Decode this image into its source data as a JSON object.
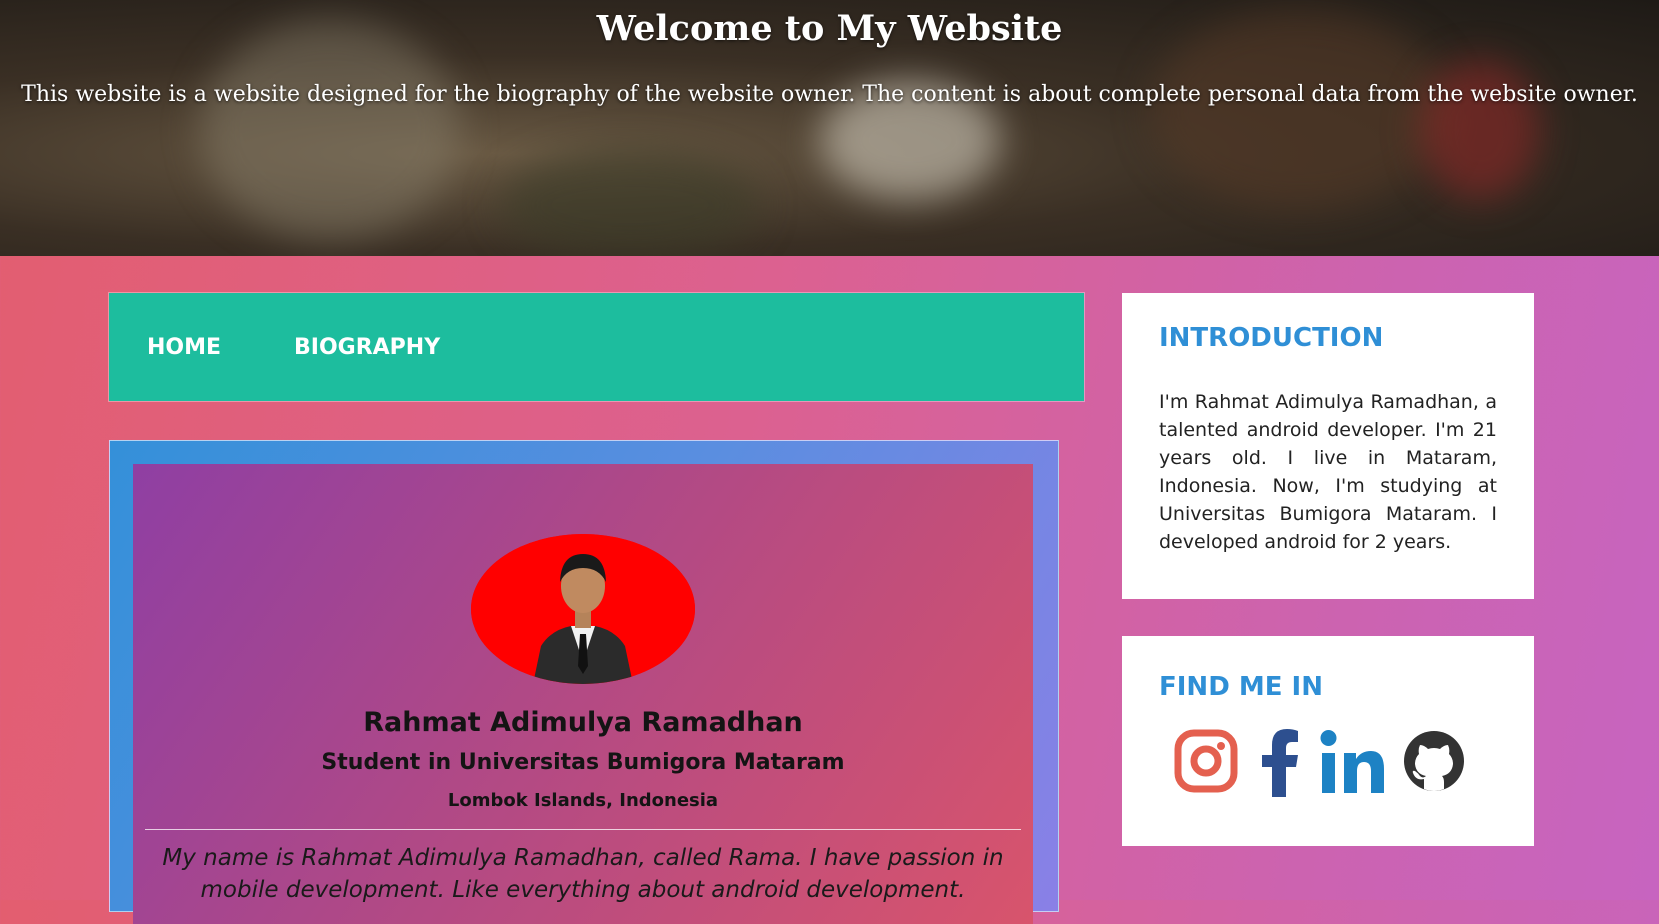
{
  "header": {
    "title": "Welcome to My Website",
    "subtitle": "This website is a website designed for the biography of the website owner. The content is about complete personal data from the website owner."
  },
  "nav": {
    "home_label": "HOME",
    "biography_label": "BIOGRAPHY",
    "color": "#1dbd9e"
  },
  "profile": {
    "name": "Rahmat Adimulya Ramadhan",
    "role": "Student in Universitas Bumigora Mataram",
    "location": "Lombok Islands, Indonesia",
    "bio": "My name is Rahmat Adimulya Ramadhan, called Rama. I have passion in mobile development. Like everything about android development."
  },
  "introduction": {
    "heading": "INTRODUCTION",
    "text": "I'm Rahmat Adimulya Ramadhan, a talented android developer. I'm 21 years old. I live in Mataram, Indonesia. Now, I'm studying at Universitas Bumigora Mataram. I developed android for 2 years."
  },
  "find_me": {
    "heading": "FIND ME IN",
    "icons": [
      "instagram-icon",
      "facebook-icon",
      "linkedin-icon",
      "github-icon"
    ]
  },
  "colors": {
    "accent": "#2f8fd6",
    "instagram": "#e4604f",
    "facebook": "#2d4f8f",
    "linkedin": "#1d82c4",
    "github": "#333333"
  }
}
